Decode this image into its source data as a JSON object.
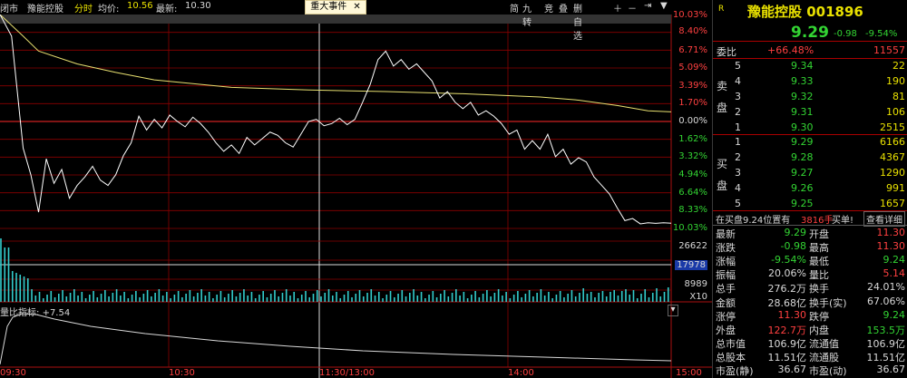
{
  "topbar": {
    "market": "闭市",
    "stock_name": "豫能控股",
    "mode": "分时",
    "avg_label": "均价:",
    "avg_value": "10.56",
    "latest_label": "最新:",
    "latest_value": "10.30",
    "event_button": "重大事件",
    "event_close": "✕",
    "tools": [
      "简",
      "九转",
      "竞",
      "叠",
      "删自选",
      "＋",
      "－",
      "⇥",
      "▼"
    ],
    "mini_box": "▾"
  },
  "price_axis": {
    "right_pcts": [
      "10.03%",
      "8.40%",
      "6.71%",
      "5.09%",
      "3.39%",
      "1.70%",
      "0.00%",
      "1.62%",
      "3.32%",
      "4.94%",
      "6.64%",
      "8.33%",
      "10.03%"
    ],
    "vol_labels": [
      "26622",
      "17978",
      "8989"
    ],
    "vol_multiplier": "X10"
  },
  "sub_indicator": {
    "label": "量比指标:",
    "value": "+7.54",
    "collapse_icon": "▾"
  },
  "time_axis": {
    "labels": [
      "09:30",
      "10:30",
      "11:30/13:00",
      "14:00",
      "15:00"
    ]
  },
  "chart_data": {
    "type": "line",
    "x": [
      "09:30",
      "10:30",
      "11:30/13:00",
      "14:00",
      "15:00"
    ],
    "ylim_pct": [
      -10.03,
      10.03
    ],
    "series": [
      {
        "name": "price_pct",
        "points": [
          [
            0,
            10.03
          ],
          [
            3,
            8.0
          ],
          [
            6,
            -2.5
          ],
          [
            8,
            -5.0
          ],
          [
            10,
            -8.5
          ],
          [
            12,
            -3.5
          ],
          [
            14,
            -5.8
          ],
          [
            16,
            -4.5
          ],
          [
            18,
            -7.2
          ],
          [
            20,
            -6.0
          ],
          [
            22,
            -5.2
          ],
          [
            24,
            -4.2
          ],
          [
            26,
            -5.5
          ],
          [
            28,
            -6.0
          ],
          [
            30,
            -5.0
          ],
          [
            32,
            -3.2
          ],
          [
            34,
            -2.0
          ],
          [
            36,
            0.5
          ],
          [
            38,
            -0.8
          ],
          [
            40,
            0.2
          ],
          [
            42,
            -0.6
          ],
          [
            44,
            0.6
          ],
          [
            46,
            0.0
          ],
          [
            48,
            -0.5
          ],
          [
            50,
            0.4
          ],
          [
            52,
            -0.2
          ],
          [
            54,
            -1.0
          ],
          [
            56,
            -2.0
          ],
          [
            58,
            -2.8
          ],
          [
            60,
            -2.2
          ],
          [
            62,
            -3.0
          ],
          [
            64,
            -1.5
          ],
          [
            66,
            -2.2
          ],
          [
            68,
            -1.6
          ],
          [
            70,
            -1.0
          ],
          [
            72,
            -1.3
          ],
          [
            74,
            -2.0
          ],
          [
            76,
            -2.4
          ],
          [
            78,
            -1.2
          ],
          [
            80,
            0.0
          ],
          [
            82,
            0.2
          ],
          [
            84,
            -0.4
          ],
          [
            86,
            -0.2
          ],
          [
            88,
            0.3
          ],
          [
            90,
            -0.3
          ],
          [
            92,
            0.2
          ],
          [
            94,
            1.8
          ],
          [
            96,
            3.5
          ],
          [
            98,
            5.8
          ],
          [
            100,
            6.6
          ],
          [
            102,
            5.2
          ],
          [
            104,
            5.8
          ],
          [
            106,
            4.9
          ],
          [
            108,
            5.4
          ],
          [
            110,
            4.6
          ],
          [
            112,
            3.8
          ],
          [
            114,
            2.2
          ],
          [
            116,
            2.8
          ],
          [
            118,
            1.8
          ],
          [
            120,
            1.2
          ],
          [
            122,
            1.8
          ],
          [
            124,
            0.6
          ],
          [
            126,
            1.0
          ],
          [
            128,
            0.5
          ],
          [
            130,
            -0.2
          ],
          [
            132,
            -1.2
          ],
          [
            134,
            -0.8
          ],
          [
            136,
            -2.6
          ],
          [
            138,
            -1.8
          ],
          [
            140,
            -2.6
          ],
          [
            142,
            -1.2
          ],
          [
            144,
            -3.3
          ],
          [
            146,
            -2.6
          ],
          [
            148,
            -4.0
          ],
          [
            150,
            -3.4
          ],
          [
            152,
            -3.8
          ],
          [
            154,
            -5.2
          ],
          [
            156,
            -6.0
          ],
          [
            158,
            -6.8
          ],
          [
            160,
            -8.1
          ],
          [
            162,
            -9.3
          ],
          [
            164,
            -9.1
          ],
          [
            166,
            -9.6
          ],
          [
            168,
            -9.5
          ],
          [
            170,
            -9.55
          ],
          [
            172,
            -9.5
          ],
          [
            174,
            -9.54
          ]
        ]
      },
      {
        "name": "avg_pct",
        "points": [
          [
            0,
            10.03
          ],
          [
            6,
            8.0
          ],
          [
            10,
            6.6
          ],
          [
            20,
            5.4
          ],
          [
            30,
            4.6
          ],
          [
            40,
            3.9
          ],
          [
            60,
            3.2
          ],
          [
            80,
            2.95
          ],
          [
            100,
            2.8
          ],
          [
            120,
            2.6
          ],
          [
            140,
            2.3
          ],
          [
            150,
            2.0
          ],
          [
            160,
            1.5
          ],
          [
            168,
            1.0
          ],
          [
            174,
            0.9
          ]
        ]
      }
    ]
  },
  "quote": {
    "region_flag": "R",
    "title": "豫能控股 001896",
    "price": "9.29",
    "change": "-0.98",
    "change_pct": "-9.54%",
    "webi_label": "委比",
    "webi_pct": "+66.48%",
    "webi_diff": "11557",
    "sell_label_1": "卖",
    "sell_label_2": "盘",
    "buy_label_1": "买",
    "buy_label_2": "盘",
    "sells": [
      {
        "n": "5",
        "p": "9.34",
        "v": "22"
      },
      {
        "n": "4",
        "p": "9.33",
        "v": "190"
      },
      {
        "n": "3",
        "p": "9.32",
        "v": "81"
      },
      {
        "n": "2",
        "p": "9.31",
        "v": "106"
      },
      {
        "n": "1",
        "p": "9.30",
        "v": "2515"
      }
    ],
    "buys": [
      {
        "n": "1",
        "p": "9.29",
        "v": "6166"
      },
      {
        "n": "2",
        "p": "9.28",
        "v": "4367"
      },
      {
        "n": "3",
        "p": "9.27",
        "v": "1290"
      },
      {
        "n": "4",
        "p": "9.26",
        "v": "991"
      },
      {
        "n": "5",
        "p": "9.25",
        "v": "1657"
      }
    ],
    "notice_left": "在买盘9.24位置有",
    "notice_mid": "3816手",
    "notice_tail": "买单!",
    "detail_btn": "查看详细",
    "stats": [
      {
        "l1": "最新",
        "v1": "9.29",
        "c1": "grn",
        "l2": "开盘",
        "v2": "11.30",
        "c2": "red"
      },
      {
        "l1": "涨跌",
        "v1": "-0.98",
        "c1": "grn",
        "l2": "最高",
        "v2": "11.30",
        "c2": "red"
      },
      {
        "l1": "涨幅",
        "v1": "-9.54%",
        "c1": "grn",
        "l2": "最低",
        "v2": "9.24",
        "c2": "grn"
      },
      {
        "l1": "振幅",
        "v1": "20.06%",
        "c1": "wht",
        "l2": "量比",
        "v2": "5.14",
        "c2": "red"
      },
      {
        "l1": "总手",
        "v1": "276.2万",
        "c1": "wht",
        "l2": "换手",
        "v2": "24.01%",
        "c2": "wht"
      },
      {
        "l1": "金额",
        "v1": "28.68亿",
        "c1": "wht",
        "l2": "换手(实)",
        "v2": "67.06%",
        "c2": "wht"
      },
      {
        "l1": "涨停",
        "v1": "11.30",
        "c1": "red",
        "l2": "跌停",
        "v2": "9.24",
        "c2": "grn"
      },
      {
        "l1": "外盘",
        "v1": "122.7万",
        "c1": "red",
        "l2": "内盘",
        "v2": "153.5万",
        "c2": "grn"
      },
      {
        "l1": "总市值",
        "v1": "106.9亿",
        "c1": "wht",
        "l2": "流通值",
        "v2": "106.9亿",
        "c2": "wht"
      },
      {
        "l1": "总股本",
        "v1": "11.51亿",
        "c1": "wht",
        "l2": "流通股",
        "v2": "11.51亿",
        "c2": "wht"
      },
      {
        "l1": "市盈(静)",
        "v1": "36.67",
        "c1": "wht",
        "l2": "市盈(动)",
        "v2": "36.67",
        "c2": "wht"
      }
    ]
  },
  "colors": {
    "grid_red": "#8b0000",
    "price_line": "#ffffff",
    "avg_line": "#e8e070",
    "volume_bar": "#3cc"
  }
}
